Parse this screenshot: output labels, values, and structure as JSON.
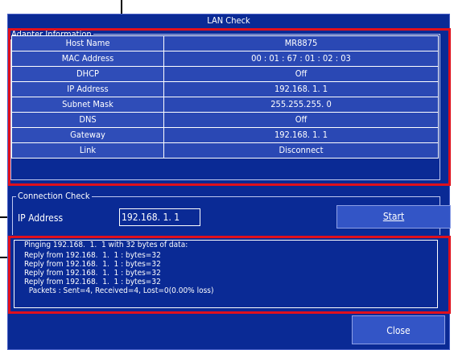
{
  "window": {
    "title": "LAN Check"
  },
  "adapter": {
    "group_label": "Adapter Information",
    "rows": [
      {
        "key": "Host Name",
        "value": "MR8875"
      },
      {
        "key": "MAC Address",
        "value": "00 : 01 : 67 : 01 : 02 : 03"
      },
      {
        "key": "DHCP",
        "value": "Off"
      },
      {
        "key": "IP Address",
        "value": "192.168.  1.  1"
      },
      {
        "key": "Subnet Mask",
        "value": "255.255.255.  0"
      },
      {
        "key": "DNS",
        "value": "Off"
      },
      {
        "key": "Gateway",
        "value": "192.168.  1.  1"
      },
      {
        "key": "Link",
        "value": "Disconnect"
      }
    ]
  },
  "connection": {
    "group_label": "Connection Check",
    "ip_label": "IP Address",
    "ip_value": "192.168.  1.  1",
    "start_label": "Start"
  },
  "log": {
    "lines": [
      "Pinging 192.168.  1.  1 with 32 bytes of data:",
      "Reply from 192.168.  1.  1 : bytes=32",
      "Reply from 192.168.  1.  1 : bytes=32",
      "Reply from 192.168.  1.  1 : bytes=32",
      "Reply from 192.168.  1.  1 : bytes=32",
      "  Packets : Sent=4, Received=4, Lost=0(0.00% loss)"
    ]
  },
  "footer": {
    "close_label": "Close"
  },
  "colors": {
    "panel": "#0a2a95",
    "cell": "#2f4db8",
    "highlight": "#e0101c"
  }
}
